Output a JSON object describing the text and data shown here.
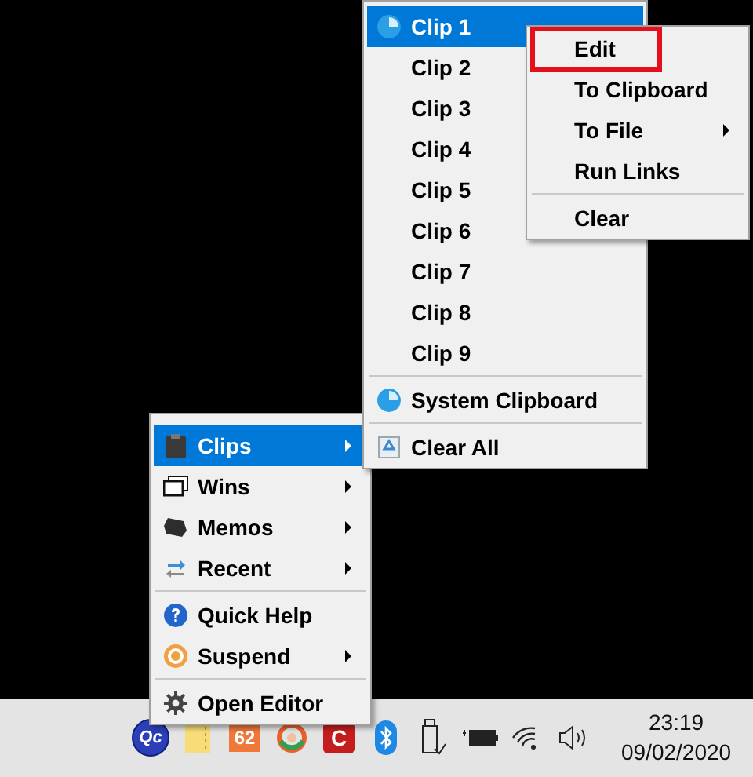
{
  "main_menu": {
    "items": [
      {
        "kind": "item",
        "label": "Clips",
        "selected": true,
        "submenu": true
      },
      {
        "kind": "item",
        "label": "Wins",
        "selected": false,
        "submenu": true
      },
      {
        "kind": "item",
        "label": "Memos",
        "selected": false,
        "submenu": true
      },
      {
        "kind": "item",
        "label": "Recent",
        "selected": false,
        "submenu": true
      },
      {
        "kind": "separator"
      },
      {
        "kind": "item",
        "label": "Quick Help",
        "selected": false,
        "submenu": false
      },
      {
        "kind": "item",
        "label": "Suspend",
        "selected": false,
        "submenu": true
      },
      {
        "kind": "separator"
      },
      {
        "kind": "item",
        "label": "Open Editor",
        "selected": false,
        "submenu": false
      }
    ]
  },
  "clips_menu": {
    "items": [
      {
        "kind": "item",
        "label": "Clip 1",
        "selected": true
      },
      {
        "kind": "item",
        "label": "Clip 2",
        "selected": false
      },
      {
        "kind": "item",
        "label": "Clip 3",
        "selected": false
      },
      {
        "kind": "item",
        "label": "Clip 4",
        "selected": false
      },
      {
        "kind": "item",
        "label": "Clip 5",
        "selected": false
      },
      {
        "kind": "item",
        "label": "Clip 6",
        "selected": false
      },
      {
        "kind": "item",
        "label": "Clip 7",
        "selected": false
      },
      {
        "kind": "item",
        "label": "Clip 8",
        "selected": false
      },
      {
        "kind": "item",
        "label": "Clip 9",
        "selected": false
      },
      {
        "kind": "separator"
      },
      {
        "kind": "item",
        "label": "System Clipboard",
        "selected": false
      },
      {
        "kind": "separator"
      },
      {
        "kind": "item",
        "label": "Clear All",
        "selected": false
      }
    ]
  },
  "clip_menu": {
    "items": [
      {
        "kind": "item",
        "label": "Edit",
        "selected": false,
        "submenu": false,
        "highlighted": true
      },
      {
        "kind": "item",
        "label": "To Clipboard",
        "selected": false,
        "submenu": false
      },
      {
        "kind": "item",
        "label": "To File",
        "selected": false,
        "submenu": true
      },
      {
        "kind": "item",
        "label": "Run Links",
        "selected": false,
        "submenu": false
      },
      {
        "kind": "separator"
      },
      {
        "kind": "item",
        "label": "Clear",
        "selected": false,
        "submenu": false
      }
    ]
  },
  "taskbar": {
    "tray_icons": [
      {
        "kind": "logo",
        "text": "Qc"
      },
      {
        "kind": "note"
      },
      {
        "kind": "badge",
        "text": "62"
      },
      {
        "kind": "ring"
      },
      {
        "kind": "letter",
        "text": "C"
      },
      {
        "kind": "bluetooth"
      },
      {
        "kind": "usb"
      },
      {
        "kind": "battery"
      },
      {
        "kind": "wifi"
      },
      {
        "kind": "volume"
      }
    ],
    "clock": {
      "time": "23:19",
      "date": "09/02/2020"
    }
  }
}
